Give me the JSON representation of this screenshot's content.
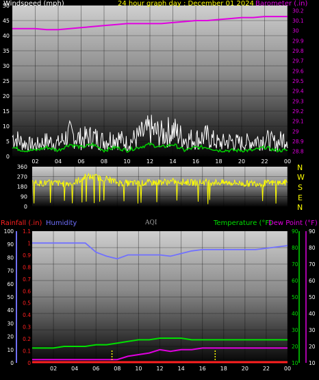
{
  "header": {
    "left_label": "Windspeed (mph)",
    "center_label": "24 hour graph day : December 01 2024",
    "right_label": "Barometer (.in)"
  },
  "hours": [
    "02",
    "04",
    "06",
    "08",
    "10",
    "12",
    "14",
    "16",
    "18",
    "20",
    "22",
    "00"
  ],
  "colors": {
    "wind_avg": "#ffffff",
    "wind_gust": "#00d000",
    "barometer": "#e000e0",
    "direction": "#ffff00",
    "rainfall": "#ff2020",
    "humidity": "#7070ff",
    "temperature": "#00e000",
    "dewpoint": "#e000e0",
    "aqi": "#a0a0a0"
  },
  "chart_data": [
    {
      "type": "line",
      "title": "24 hour graph day : December 01 2024",
      "ylabel_left": "Windspeed (mph)",
      "ylabel_right": "Barometer (.in)",
      "x_ticks": [
        "02",
        "04",
        "06",
        "08",
        "10",
        "12",
        "14",
        "16",
        "18",
        "20",
        "22",
        "00"
      ],
      "y_left_ticks": [
        "0",
        "5",
        "10",
        "15",
        "20",
        "25",
        "30",
        "35",
        "40",
        "45",
        "50"
      ],
      "y_left_range": [
        0,
        50
      ],
      "y_right_ticks": [
        "28.8",
        "28.9",
        "29",
        "29.1",
        "29.2",
        "29.3",
        "29.4",
        "29.5",
        "29.6",
        "29.7",
        "29.8",
        "29.9",
        "30",
        "30.1",
        "30.2"
      ],
      "y_right_range": [
        28.75,
        30.25
      ],
      "series": [
        {
          "name": "Barometer (.in)",
          "axis": "right",
          "x": [
            0,
            1,
            2,
            3,
            4,
            5,
            6,
            7,
            8,
            9,
            10,
            11,
            12,
            13,
            14,
            15,
            16,
            17,
            18,
            19,
            20,
            21,
            22,
            23,
            24
          ],
          "values": [
            30.02,
            30.02,
            30.02,
            30.01,
            30.01,
            30.02,
            30.03,
            30.04,
            30.05,
            30.06,
            30.07,
            30.07,
            30.07,
            30.07,
            30.08,
            30.09,
            30.1,
            30.1,
            30.11,
            30.12,
            30.13,
            30.13,
            30.14,
            30.14,
            30.14
          ]
        },
        {
          "axis": "left",
          "x": [
            0,
            1,
            2,
            3,
            4,
            5,
            6,
            7,
            8,
            9,
            10,
            11,
            12,
            13,
            14,
            15,
            16,
            17,
            18,
            19,
            20,
            21,
            22,
            23,
            24
          ],
          "values": [
            9,
            6,
            5,
            7,
            6,
            10,
            8,
            9,
            7,
            9,
            6,
            9,
            12,
            10,
            12,
            8,
            8,
            9,
            6,
            7,
            6,
            7,
            8,
            6,
            9
          ]
        },
        {
          "axis": "left",
          "x": [
            0,
            1,
            2,
            3,
            4,
            5,
            6,
            7,
            8,
            9,
            10,
            11,
            12,
            13,
            14,
            15,
            16,
            17,
            18,
            19,
            20,
            21,
            22,
            23,
            24
          ],
          "values": [
            3,
            2,
            2,
            3,
            2,
            4,
            3,
            4,
            2,
            3,
            2,
            3,
            4,
            3,
            4,
            2,
            3,
            3,
            2,
            2,
            2,
            2,
            3,
            2,
            2
          ]
        }
      ]
    },
    {
      "type": "line",
      "y_ticks": [
        "360",
        "270",
        "180",
        "90",
        "0"
      ],
      "y_range": [
        0,
        360
      ],
      "compass_labels": [
        "N",
        "W",
        "S",
        "E",
        "N"
      ],
      "series": [
        {
          "axis": "left",
          "x": [
            0,
            1,
            2,
            3,
            4,
            5,
            6,
            7,
            8,
            9,
            10,
            11,
            12,
            13,
            14,
            15,
            16,
            17,
            18,
            19,
            20,
            21,
            22,
            23,
            24
          ],
          "values": [
            220,
            210,
            215,
            205,
            215,
            270,
            265,
            250,
            215,
            210,
            210,
            215,
            220,
            225,
            225,
            215,
            220,
            220,
            215,
            215,
            205,
            210,
            210,
            215,
            215
          ]
        }
      ]
    },
    {
      "type": "line",
      "labels": {
        "rainfall": "Rainfall (.in)",
        "humidity": "Humidity",
        "aqi": "AQI",
        "temperature": "Temperature (°F)",
        "dewpoint": "Dew Point (°F)"
      },
      "x_ticks": [
        "02",
        "04",
        "06",
        "08",
        "10",
        "12",
        "14",
        "16",
        "18",
        "20",
        "22",
        "00"
      ],
      "humidity_ticks": [
        "100",
        "90",
        "80",
        "70",
        "60",
        "50",
        "40",
        "30",
        "20",
        "10",
        "0"
      ],
      "humidity_range": [
        0,
        100
      ],
      "rain_ticks": [
        "1.1",
        "1",
        "0.9",
        "0.8",
        "0.7",
        "0.6",
        "0.5",
        "0.4",
        "0.3",
        "0.2",
        "0.1",
        "0"
      ],
      "rain_range": [
        0,
        1.1
      ],
      "temp_ticks_left": [
        "90",
        "80",
        "70",
        "60",
        "50",
        "40",
        "30",
        "20",
        "10"
      ],
      "temp_ticks_right": [
        "90",
        "80",
        "70",
        "60",
        "50",
        "40",
        "30",
        "20",
        "10"
      ],
      "temp_range": [
        10,
        90
      ],
      "series": [
        {
          "name": "Humidity",
          "axis": "humidity",
          "x": [
            0,
            1,
            2,
            3,
            4,
            5,
            6,
            7,
            8,
            9,
            10,
            11,
            12,
            13,
            14,
            15,
            16,
            17,
            18,
            19,
            20,
            21,
            22,
            23,
            24
          ],
          "values": [
            91,
            91,
            91,
            91,
            91,
            91,
            84,
            81,
            79,
            82,
            82,
            82,
            82,
            81,
            83,
            85,
            86,
            86,
            86,
            86,
            86,
            86,
            87,
            88,
            89
          ]
        },
        {
          "name": "Temperature (°F)",
          "axis": "temp",
          "x": [
            0,
            1,
            2,
            3,
            4,
            5,
            6,
            7,
            8,
            9,
            10,
            11,
            12,
            13,
            14,
            15,
            16,
            17,
            18,
            19,
            20,
            21,
            22,
            23,
            24
          ],
          "values": [
            19,
            19,
            19,
            20,
            20,
            20,
            21,
            21,
            22,
            23,
            24,
            24,
            25,
            25,
            25,
            24,
            24,
            24,
            24,
            24,
            24,
            24,
            24,
            24,
            24
          ]
        },
        {
          "name": "Dew Point (°F)",
          "axis": "temp",
          "x": [
            0,
            1,
            2,
            3,
            4,
            5,
            6,
            7,
            8,
            9,
            10,
            11,
            12,
            13,
            14,
            15,
            16,
            17,
            18,
            19,
            20,
            21,
            22,
            23,
            24
          ],
          "values": [
            12,
            12,
            12,
            12,
            12,
            12,
            12,
            12,
            12,
            14,
            15,
            16,
            18,
            17,
            18,
            18,
            19,
            19,
            19,
            19,
            19,
            19,
            19,
            19,
            19
          ]
        },
        {
          "name": "Rainfall (.in)",
          "axis": "rain",
          "x": [
            0,
            24
          ],
          "values": [
            0,
            0
          ]
        }
      ]
    }
  ]
}
